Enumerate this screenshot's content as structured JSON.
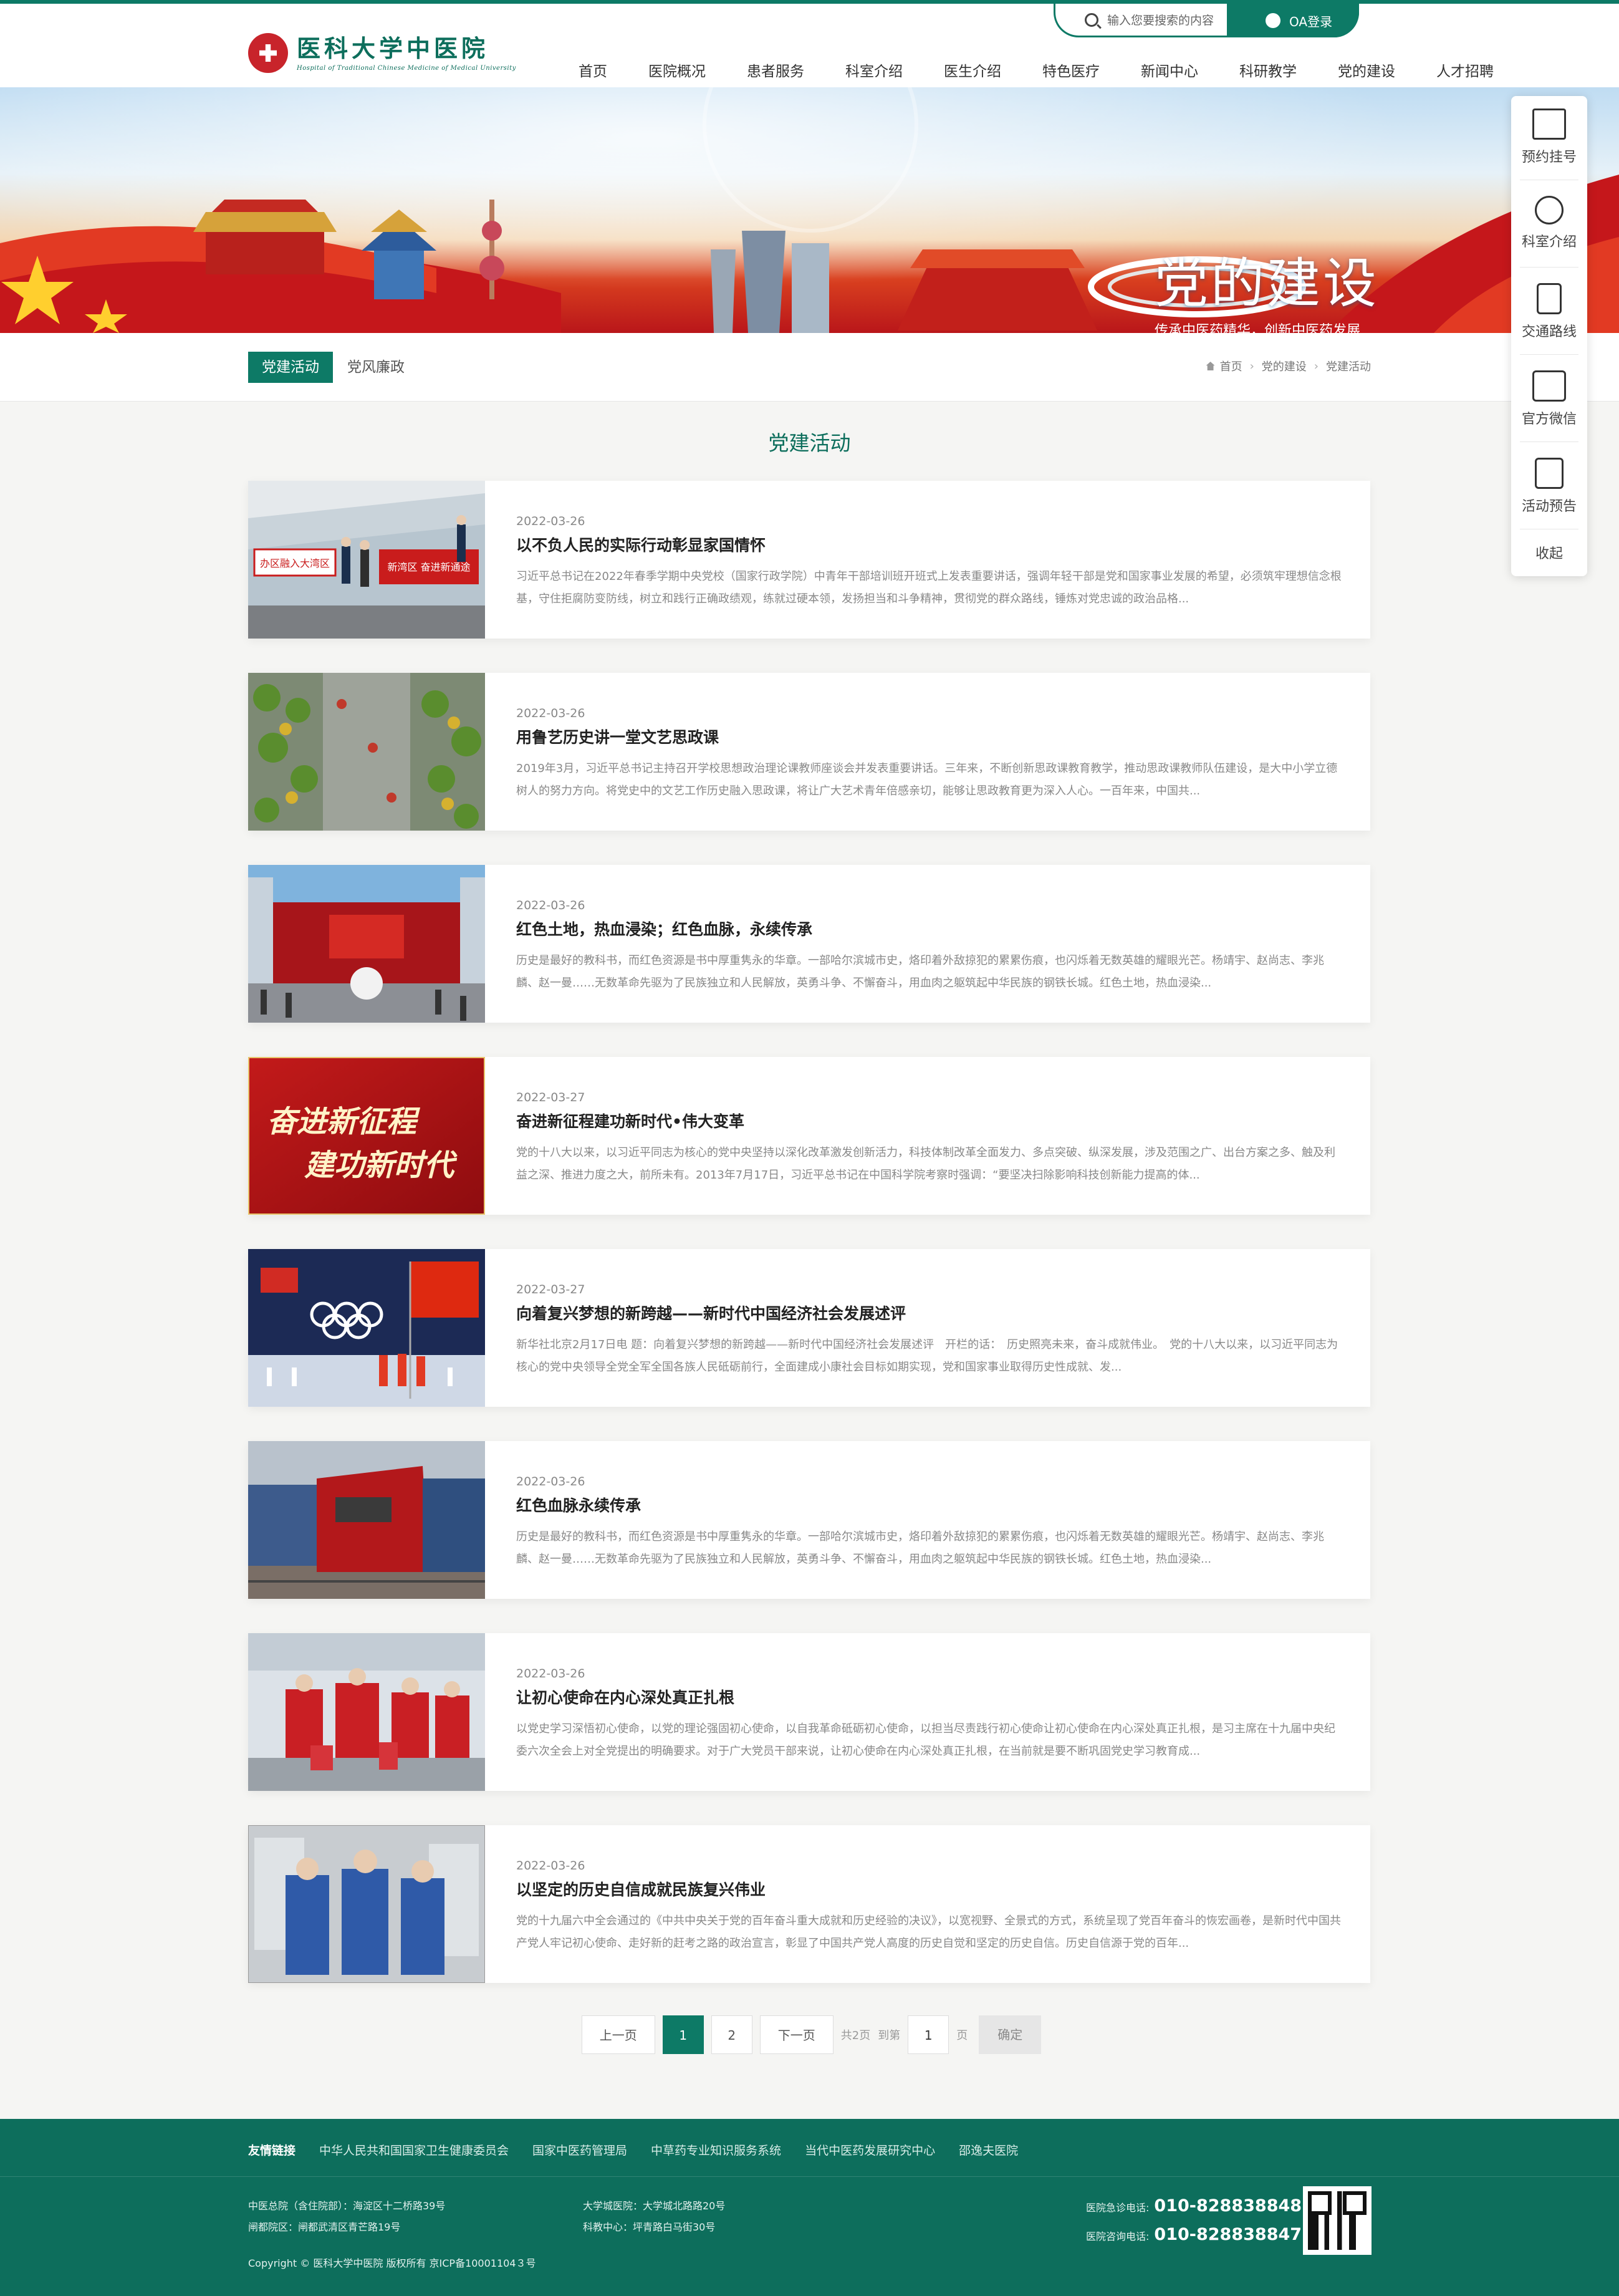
{
  "header": {
    "logo_cn": "医科大学中医院",
    "logo_en": "Hospital of Traditional Chinese Medicine of Medical University",
    "search_placeholder": "输入您要搜索的内容",
    "oa_login": "OA登录",
    "nav": [
      "首页",
      "医院概况",
      "患者服务",
      "科室介绍",
      "医生介绍",
      "特色医疗",
      "新闻中心",
      "科研教学",
      "党的建设",
      "人才招聘"
    ],
    "nav_active": "党的建设"
  },
  "banner": {
    "title": "党的建设",
    "subtitle": "传承中医药精华，创新中医药发展"
  },
  "subnav": {
    "tabs": [
      "党建活动",
      "党风廉政"
    ],
    "breadcrumb": [
      "首页",
      "党的建设",
      "党建活动"
    ]
  },
  "section_title": "党建活动",
  "articles": [
    {
      "date": "2022-03-26",
      "title": "以不负人民的实际行动彰显家国情怀",
      "desc": "习近平总书记在2022年春季学期中央党校（国家行政学院）中青年干部培训班开班式上发表重要讲话，强调年轻干部是党和国家事业发展的希望，必须筑牢理想信念根基，守住拒腐防变防线，树立和践行正确政绩观，练就过硬本领，发扬担当和斗争精神，贯彻党的群众路线，锤炼对党忠诚的政治品格..."
    },
    {
      "date": "2022-03-26",
      "title": "用鲁艺历史讲一堂文艺思政课",
      "desc": "2019年3月，习近平总书记主持召开学校思想政治理论课教师座谈会并发表重要讲话。三年来，不断创新思政课教育教学，推动思政课教师队伍建设，是大中小学立德树人的努力方向。将党史中的文艺工作历史融入思政课，将让广大艺术青年倍感亲切，能够让思政教育更为深入人心。一百年来，中国共..."
    },
    {
      "date": "2022-03-26",
      "title": "红色土地，热血浸染；红色血脉，永续传承",
      "desc": "历史是最好的教科书，而红色资源是书中厚重隽永的华章。一部哈尔滨城市史，烙印着外敌掠犯的累累伤痕，也闪烁着无数英雄的耀眼光芒。杨靖宇、赵尚志、李兆麟、赵一曼……无数革命先驱为了民族独立和人民解放，英勇斗争、不懈奋斗，用血肉之躯筑起中华民族的钢铁长城。红色土地，热血浸染..."
    },
    {
      "date": "2022-03-27",
      "title": "奋进新征程建功新时代•伟大变革",
      "desc": "党的十八大以来，以习近平同志为核心的党中央坚持以深化改革激发创新活力，科技体制改革全面发力、多点突破、纵深发展，涉及范围之广、出台方案之多、触及利益之深、推进力度之大，前所未有。2013年7月17日，习近平总书记在中国科学院考察时强调：“要坚决扫除影响科技创新能力提高的体..."
    },
    {
      "date": "2022-03-27",
      "title": "向着复兴梦想的新跨越——新时代中国经济社会发展述评",
      "desc": "新华社北京2月17日电 题：向着复兴梦想的新跨越——新时代中国经济社会发展述评　开栏的话：　历史照亮未来，奋斗成就伟业。　党的十八大以来，以习近平同志为核心的党中央领导全党全军全国各族人民砥砺前行，全面建成小康社会目标如期实现，党和国家事业取得历史性成就、发..."
    },
    {
      "date": "2022-03-26",
      "title": "红色血脉永续传承",
      "desc": "历史是最好的教科书，而红色资源是书中厚重隽永的华章。一部哈尔滨城市史，烙印着外敌掠犯的累累伤痕，也闪烁着无数英雄的耀眼光芒。杨靖宇、赵尚志、李兆麟、赵一曼……无数革命先驱为了民族独立和人民解放，英勇斗争、不懈奋斗，用血肉之躯筑起中华民族的钢铁长城。红色土地，热血浸染..."
    },
    {
      "date": "2022-03-26",
      "title": "让初心使命在内心深处真正扎根",
      "desc": "以党史学习深悟初心使命，以党的理论强固初心使命，以自我革命砥砺初心使命，以担当尽责践行初心使命让初心使命在内心深处真正扎根，是习主席在十九届中央纪委六次全会上对全党提出的明确要求。对于广大党员干部来说，让初心使命在内心深处真正扎根，在当前就是要不断巩固党史学习教育成..."
    },
    {
      "date": "2022-03-26",
      "title": "以坚定的历史自信成就民族复兴伟业",
      "desc": "党的十九届六中全会通过的《中共中央关于党的百年奋斗重大成就和历史经验的决议》，以宽视野、全景式的方式，系统呈现了党百年奋斗的恢宏画卷，是新时代中国共产党人牢记初心使命、走好新的赶考之路的政治宣言，彰显了中国共产党人高度的历史自觉和坚定的历史自信。历史自信源于党的百年..."
    }
  ],
  "thumb_texts": {
    "t1_banner_left": "办区融入大湾区",
    "t1_banner_right": "新湾区 奋进新通途",
    "t4_line1": "奋进新征程",
    "t4_line2": "建功新时代"
  },
  "pagination": {
    "prev": "上一页",
    "pages": [
      "1",
      "2"
    ],
    "current": "1",
    "next": "下一页",
    "total": "共2页",
    "goto": "到第",
    "goto_value": "1",
    "unit": "页",
    "confirm": "确定"
  },
  "sidebar": [
    "预约挂号",
    "科室介绍",
    "交通路线",
    "官方微信",
    "活动预告",
    "收起"
  ],
  "footer": {
    "links_title": "友情链接",
    "links": [
      "中华人民共和国国家卫生健康委员会",
      "国家中医药管理局",
      "中草药专业知识服务系统",
      "当代中医药发展研究中心",
      "邵逸夫医院"
    ],
    "addr1": "中医总院（含住院部）：海淀区十二桥路39号",
    "addr2": "闸都院区：闸都武清区青芒路19号",
    "addr3": "大学城医院：大学城北路路20号",
    "addr4": "科教中心：坪青路白马街30号",
    "tel1_label": "医院急诊电话:",
    "tel1": "010-828838848",
    "tel2_label": "医院咨询电话:",
    "tel2": "010-828838847",
    "copyright": "Copyright © 医科大学中医院 版权所有 京ICP备10001104３号"
  },
  "colors": {
    "primary": "#0d7a66",
    "footer": "#0d6e5c"
  }
}
